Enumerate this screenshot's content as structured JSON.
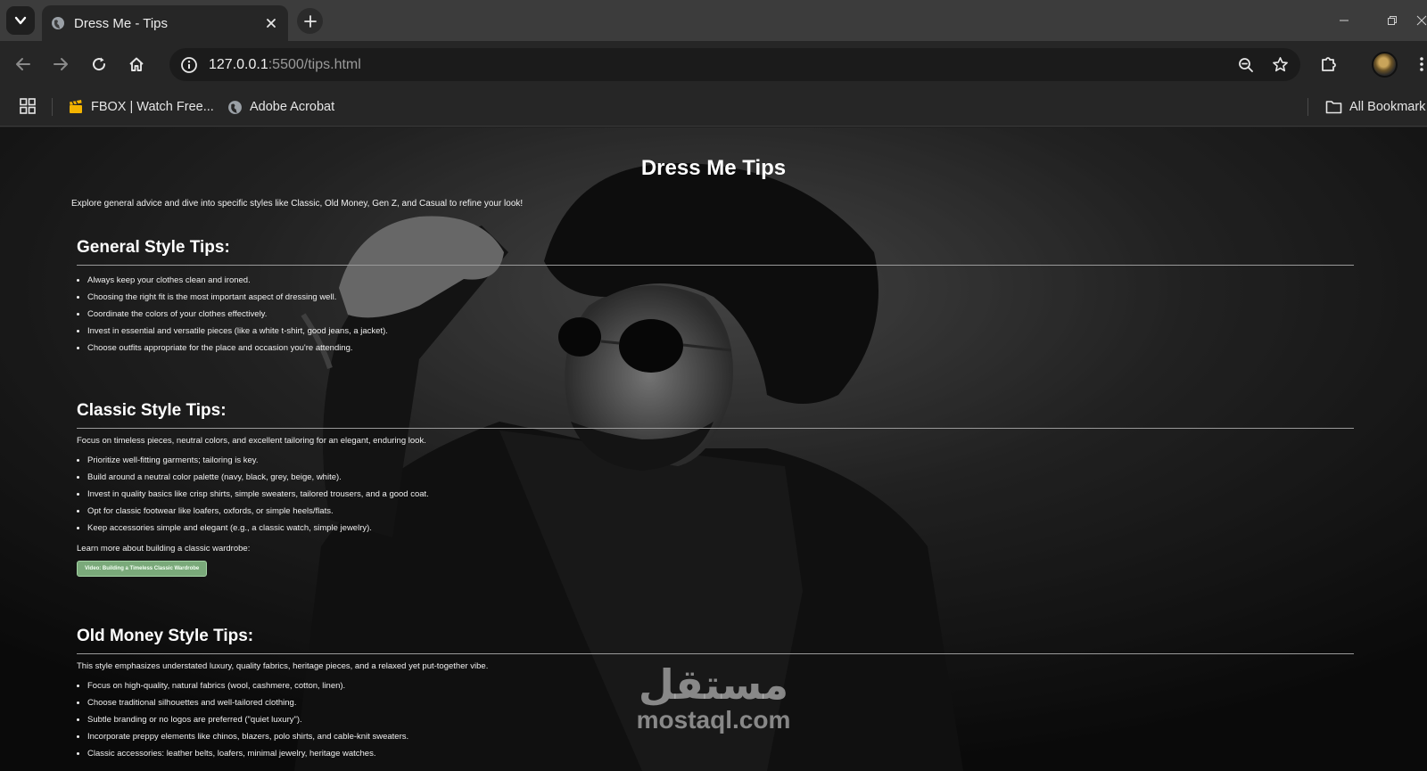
{
  "browser": {
    "tab_title": "Dress Me - Tips",
    "url_host": "127.0.0.1",
    "url_path": ":5500/tips.html",
    "bookmarks": [
      {
        "label": "FBOX | Watch Free..."
      },
      {
        "label": "Adobe Acrobat"
      }
    ],
    "all_bookmarks_label": "All Bookmark"
  },
  "page": {
    "title": "Dress Me Tips",
    "intro": "Explore general advice and dive into specific styles like Classic, Old Money, Gen Z, and Casual to refine your look!",
    "general": {
      "heading": "General Style Tips:",
      "items": [
        "Always keep your clothes clean and ironed.",
        "Choosing the right fit is the most important aspect of dressing well.",
        "Coordinate the colors of your clothes effectively.",
        "Invest in essential and versatile pieces (like a white t-shirt, good jeans, a jacket).",
        "Choose outfits appropriate for the place and occasion you're attending."
      ]
    },
    "classic": {
      "heading": "Classic Style Tips:",
      "description": "Focus on timeless pieces, neutral colors, and excellent tailoring for an elegant, enduring look.",
      "items": [
        "Prioritize well-fitting garments; tailoring is key.",
        "Build around a neutral color palette (navy, black, grey, beige, white).",
        "Invest in quality basics like crisp shirts, simple sweaters, tailored trousers, and a good coat.",
        "Opt for classic footwear like loafers, oxfords, or simple heels/flats.",
        "Keep accessories simple and elegant (e.g., a classic watch, simple jewelry)."
      ],
      "learn_more": "Learn more about building a classic wardrobe:",
      "video_button": "Video: Building a Timeless Classic Wardrobe"
    },
    "old_money": {
      "heading": "Old Money Style Tips:",
      "description": "This style emphasizes understated luxury, quality fabrics, heritage pieces, and a relaxed yet put-together vibe.",
      "items": [
        "Focus on high-quality, natural fabrics (wool, cashmere, cotton, linen).",
        "Choose traditional silhouettes and well-tailored clothing.",
        "Subtle branding or no logos are preferred (\"quiet luxury\").",
        "Incorporate preppy elements like chinos, blazers, polo shirts, and cable-knit sweaters.",
        "Classic accessories: leather belts, loafers, minimal jewelry, heritage watches."
      ]
    }
  },
  "watermark": {
    "arabic": "مستقل",
    "latin": "mostaql.com"
  },
  "icons": {
    "tab_search": "chevron-down-icon",
    "favicon": "globe-icon",
    "close": "close-icon",
    "new_tab": "plus-icon",
    "back": "arrow-left-icon",
    "forward": "arrow-right-icon",
    "reload": "reload-icon",
    "home": "home-icon",
    "site_info": "info-icon",
    "zoom": "zoom-icon",
    "star": "star-icon",
    "extensions": "puzzle-icon",
    "menu": "kebab-menu-icon",
    "apps": "apps-grid-icon",
    "folder": "folder-icon"
  },
  "colors": {
    "browser_chrome": "#262626",
    "tab_strip": "#3c3c3c",
    "button_green": "#7aa97a"
  }
}
